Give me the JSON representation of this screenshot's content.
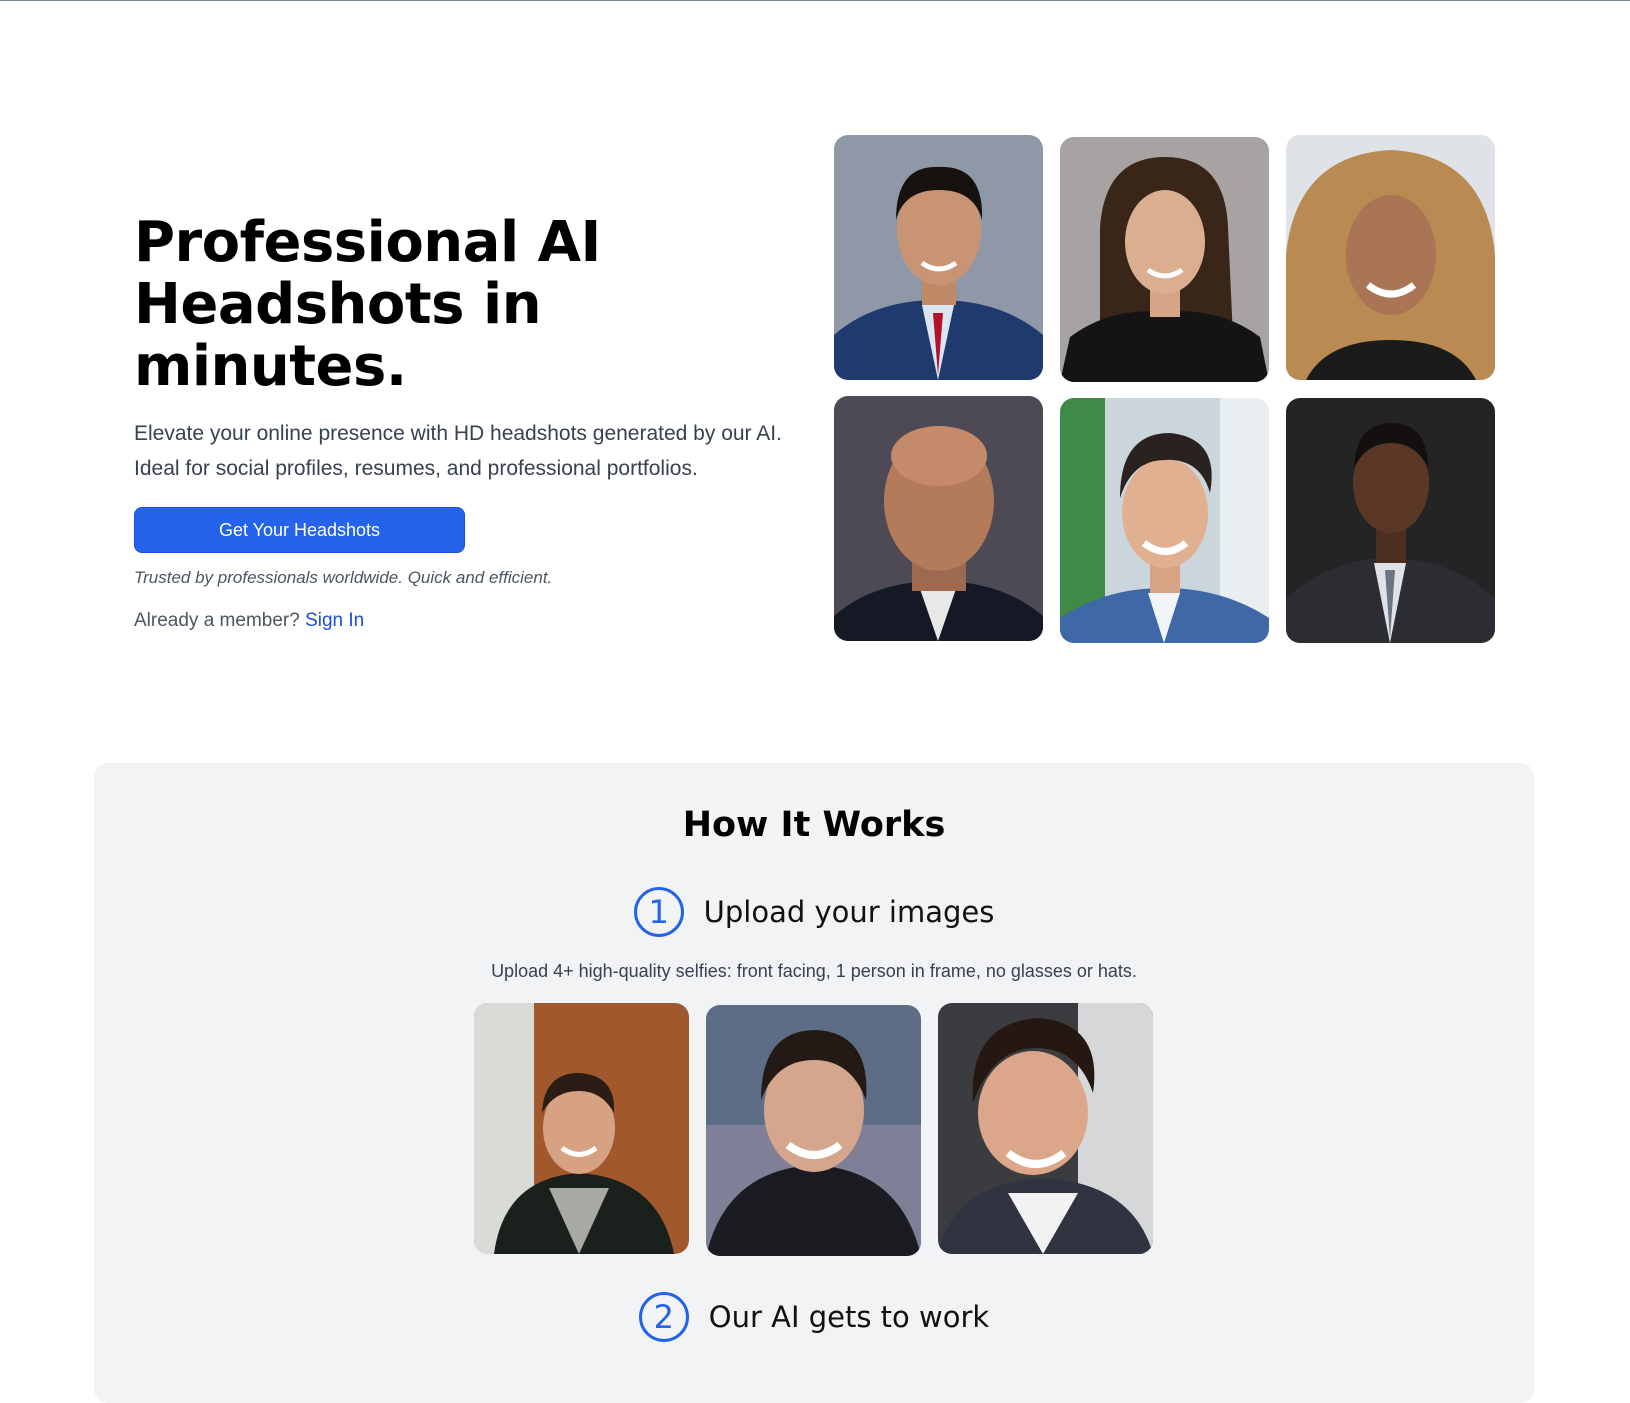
{
  "hero": {
    "title_line1": "Professional AI",
    "title_line2": "Headshots in minutes.",
    "subtitle": "Elevate your online presence with HD headshots generated by our AI. Ideal for social profiles, resumes, and professional portfolios.",
    "cta_label": "Get Your Headshots",
    "trusted_note": "Trusted by professionals worldwide. Quick and efficient.",
    "member_prompt": "Already a member?",
    "sign_in_label": "Sign In"
  },
  "how_it_works": {
    "title": "How It Works",
    "steps": [
      {
        "number": "1",
        "title": "Upload your images",
        "description": "Upload 4+ high-quality selfies: front facing, 1 person in frame, no glasses or hats."
      },
      {
        "number": "2",
        "title": "Our AI gets to work"
      }
    ]
  },
  "colors": {
    "accent": "#2563eb",
    "section_bg": "#f2f3f5",
    "text_muted": "#4b5563"
  }
}
